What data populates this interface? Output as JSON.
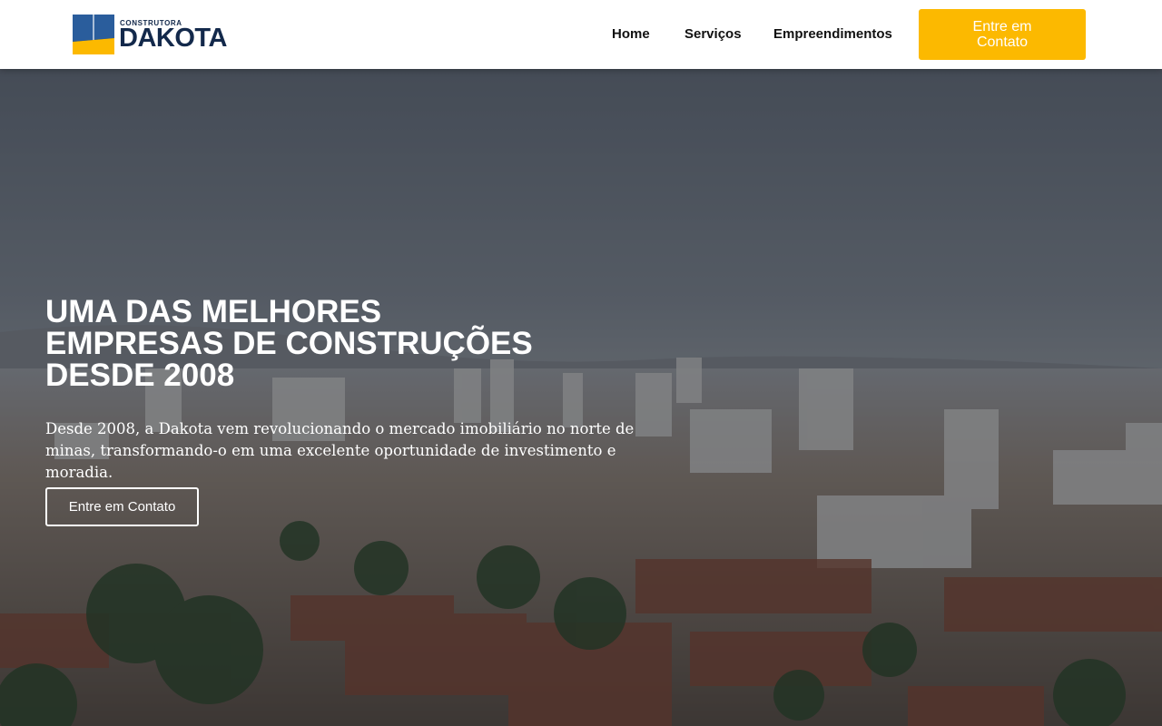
{
  "header": {
    "logo": {
      "small_text": "CONSTRUTORA",
      "brand_text": "DAKOTA"
    },
    "nav": [
      {
        "label": "Home"
      },
      {
        "label": "Serviços"
      },
      {
        "label": "Empreendimentos"
      }
    ],
    "cta_label": "Entre em Contato"
  },
  "hero": {
    "title": "UMA DAS MELHORES\nEMPRESAS DE CONSTRUÇÕES\nDESDE 2008",
    "text": "Desde 2008, a Dakota vem revolucionando o mercado imobiliário no norte de minas, transformando-o em uma excelente oportunidade de investimento e moradia.",
    "cta_label": "Entre em Contato"
  },
  "colors": {
    "accent": "#fcb900",
    "brand_navy": "#13294b",
    "brand_blue": "#2a5d9c"
  }
}
